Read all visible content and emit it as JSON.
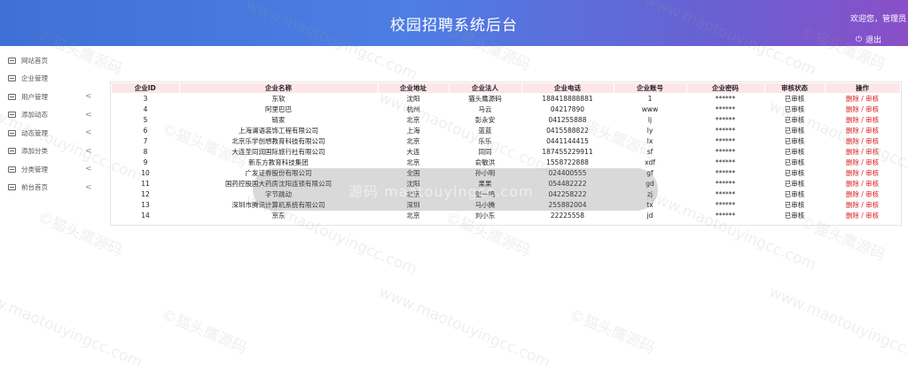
{
  "header": {
    "title": "校园招聘系统后台",
    "welcome": "欢迎您，管理员",
    "logout": "退出"
  },
  "sidebar": {
    "items": [
      {
        "label": "网站首页",
        "arrow": ""
      },
      {
        "label": "企业管理",
        "arrow": ""
      },
      {
        "label": "用户管理",
        "arrow": "<"
      },
      {
        "label": "添加动态",
        "arrow": "<"
      },
      {
        "label": "动态管理",
        "arrow": "<"
      },
      {
        "label": "添加分类",
        "arrow": "<"
      },
      {
        "label": "分类管理",
        "arrow": "<"
      },
      {
        "label": "前台首页",
        "arrow": "<"
      }
    ]
  },
  "table": {
    "headers": [
      "企业ID",
      "企业名称",
      "企业地址",
      "企业法人",
      "企业电话",
      "企业账号",
      "企业密码",
      "审核状态",
      "操作"
    ],
    "action_delete": "删除",
    "action_sep": " / ",
    "action_review": "审核",
    "rows": [
      [
        "3",
        "东软",
        "沈阳",
        "猫头鹰源码",
        "188418888881",
        "1",
        "******",
        "已审核"
      ],
      [
        "4",
        "阿里巴巴",
        "杭州",
        "马云",
        "04217890",
        "www",
        "******",
        "已审核"
      ],
      [
        "5",
        "链家",
        "北京",
        "彭永安",
        "041255888",
        "lj",
        "******",
        "已审核"
      ],
      [
        "6",
        "上海澜语装饰工程有限公司",
        "上海",
        "蓝蓝",
        "0415588822",
        "ly",
        "******",
        "已审核"
      ],
      [
        "7",
        "北京乐学创想教育科技有限公司",
        "北京",
        "乐乐",
        "0441144415",
        "lx",
        "******",
        "已审核"
      ],
      [
        "8",
        "大连圣同润国际旅行社有限公司",
        "大连",
        "同同",
        "187455229911",
        "sf",
        "******",
        "已审核"
      ],
      [
        "9",
        "新东方教育科技集团",
        "北京",
        "俞敏洪",
        "1558722888",
        "xdf",
        "******",
        "已审核"
      ],
      [
        "10",
        "广发证券股份有限公司",
        "全国",
        "孙小明",
        "024400555",
        "gf",
        "******",
        "已审核"
      ],
      [
        "11",
        "国药控股国大药房沈阳连锁有限公司",
        "沈阳",
        "果果",
        "054482222",
        "gd",
        "******",
        "已审核"
      ],
      [
        "12",
        "字节跳动",
        "北京",
        "张一鸣",
        "042258222",
        "zj",
        "******",
        "已审核"
      ],
      [
        "13",
        "深圳市腾讯计算机系统有限公司",
        "深圳",
        "马小腾",
        "255882004",
        "tx",
        "******",
        "已审核"
      ],
      [
        "14",
        "京东",
        "北京",
        "刘小东",
        "22225558",
        "jd",
        "******",
        "已审核"
      ]
    ]
  },
  "watermark": {
    "text": "©猫头鹰源码",
    "url": "www.maotouyingcc.com"
  },
  "overlay": {
    "text": "源码  maotouyingcc.com"
  }
}
